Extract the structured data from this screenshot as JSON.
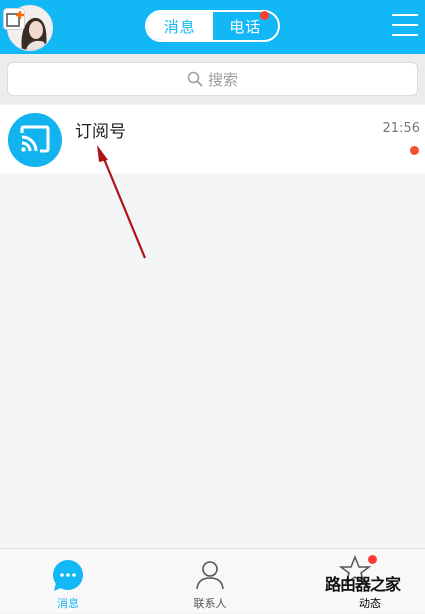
{
  "header": {
    "tabs": {
      "messages": "消息",
      "phone": "电话"
    },
    "phone_has_badge": true
  },
  "search": {
    "placeholder": "搜索"
  },
  "conversations": [
    {
      "title": "订阅号",
      "time": "21:56",
      "unread": true
    }
  ],
  "bottom_nav": {
    "items": [
      {
        "label": "消息",
        "active": true
      },
      {
        "label": "联系人",
        "active": false
      },
      {
        "label": "动态",
        "active": false,
        "has_badge": true
      }
    ]
  },
  "watermark": {
    "text": "路由器之家"
  },
  "colors": {
    "accent": "#12b7f5",
    "badge": "#ff3b30",
    "arrow": "#b1121a"
  }
}
